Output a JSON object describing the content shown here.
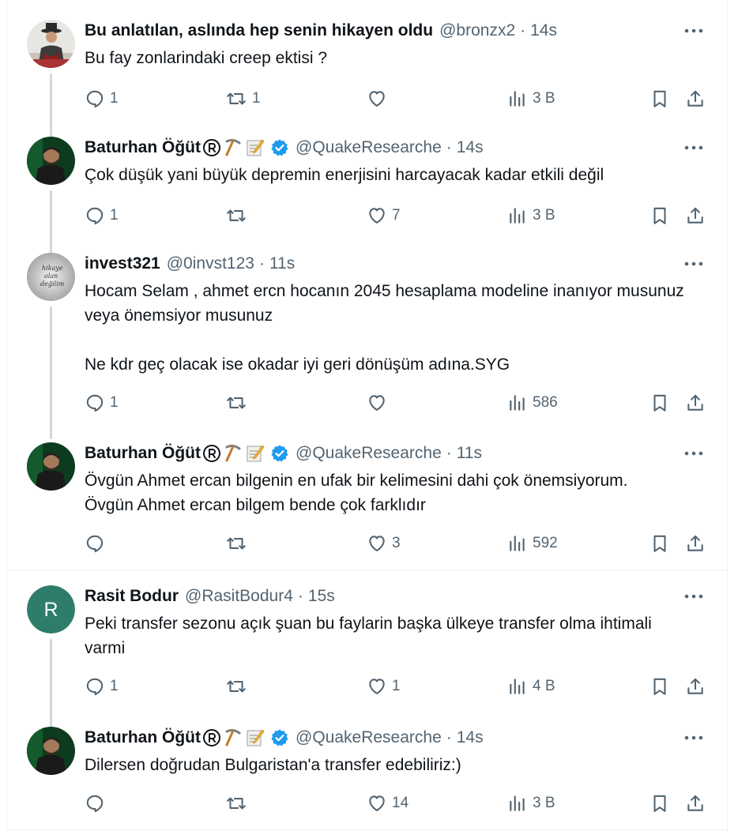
{
  "tweets": [
    {
      "name": "Bu anlatılan, aslında hep senin hikayen oldu",
      "handle": "@bronzx2",
      "time": "14s",
      "text": "Bu fay zonlarindaki creep ektisi ?",
      "verified": false,
      "emojis": [],
      "avatar": "photo-person-hat",
      "counts": {
        "reply": "1",
        "retweet": "1",
        "like": "",
        "views": "3 B"
      }
    },
    {
      "name": "Baturhan Öğüt",
      "handle": "@QuakeResearche",
      "time": "14s",
      "text": "Çok düşük yani büyük depremin enerjisini harcayacak kadar etkili değil",
      "verified": true,
      "emojis": [
        "registered-sign-icon",
        "pick-icon",
        "memo-icon"
      ],
      "avatar": "photo-man-dark",
      "counts": {
        "reply": "1",
        "retweet": "",
        "like": "7",
        "views": "3 B"
      }
    },
    {
      "name": "invest321",
      "handle": "@0invst123",
      "time": "11s",
      "text": "Hocam Selam , ahmet ercn hocanın 2045 hesaplama modeline inanıyor musunuz veya önemsiyor musunuz\n\nNe kdr geç olacak ise okadar iyi geri dönüşüm adına.SYG",
      "verified": false,
      "emojis": [],
      "avatar": "photo-handwriting",
      "avatar_text": [
        "hikaye",
        "olan",
        "değilim"
      ],
      "counts": {
        "reply": "1",
        "retweet": "",
        "like": "",
        "views": "586"
      }
    },
    {
      "name": "Baturhan Öğüt",
      "handle": "@QuakeResearche",
      "time": "11s",
      "text": "Övgün Ahmet ercan bilgenin en ufak bir kelimesini dahi çok önemsiyorum.\nÖvgün Ahmet ercan bilgem bende çok farklıdır",
      "verified": true,
      "emojis": [
        "registered-sign-icon",
        "pick-icon",
        "memo-icon"
      ],
      "avatar": "photo-man-dark",
      "counts": {
        "reply": "",
        "retweet": "",
        "like": "3",
        "views": "592"
      }
    },
    {
      "name": "Rasit Bodur",
      "handle": "@RasitBodur4",
      "time": "15s",
      "text": "Peki transfer sezonu açık şuan bu faylarin başka ülkeye transfer olma ihtimali varmi",
      "verified": false,
      "emojis": [],
      "avatar": "letter",
      "avatar_letter": "R",
      "avatar_color": "#2e7d6b",
      "counts": {
        "reply": "1",
        "retweet": "",
        "like": "1",
        "views": "4 B"
      }
    },
    {
      "name": "Baturhan Öğüt",
      "handle": "@QuakeResearche",
      "time": "14s",
      "text": "Dilersen doğrudan Bulgaristan'a transfer edebiliriz:)",
      "verified": true,
      "emojis": [
        "registered-sign-icon",
        "pick-icon",
        "memo-icon"
      ],
      "avatar": "photo-man-dark",
      "counts": {
        "reply": "",
        "retweet": "",
        "like": "14",
        "views": "3 B"
      }
    }
  ],
  "colors": {
    "text": "#0f1419",
    "secondary": "#536471",
    "verified": "#1d9bf0",
    "line": "#cfd9de",
    "divider": "#eff3f4"
  }
}
